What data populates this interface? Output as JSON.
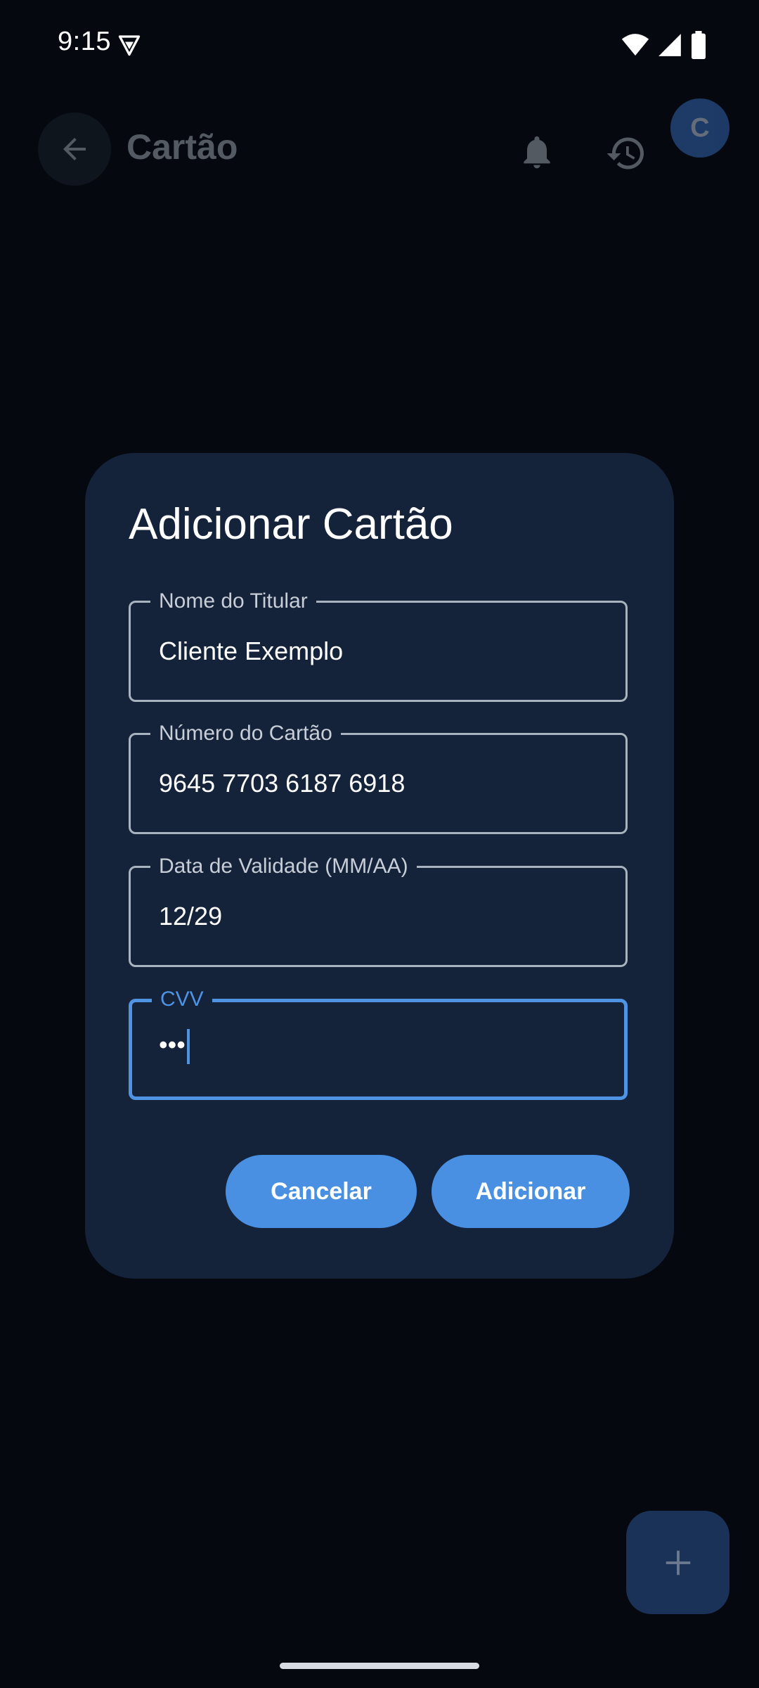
{
  "status_bar": {
    "time": "9:15"
  },
  "app_bar": {
    "title": "Cartão",
    "avatar_initial": "C"
  },
  "dialog": {
    "title": "Adicionar Cartão",
    "fields": [
      {
        "label": "Nome do Titular",
        "value": "Cliente Exemplo"
      },
      {
        "label": "Número do Cartão",
        "value": "9645 7703 6187 6918"
      },
      {
        "label": "Data de Validade (MM/AA)",
        "value": "12/29"
      },
      {
        "label": "CVV",
        "value": "•••"
      }
    ],
    "cancel_label": "Cancelar",
    "add_label": "Adicionar"
  },
  "colors": {
    "accent": "#4a90e2",
    "dialog_bg": "#14223a",
    "background": "#05090f"
  },
  "icons": [
    "vpn-key-icon",
    "wifi-icon",
    "signal-icon",
    "battery-icon",
    "arrow-back-icon",
    "bell-icon",
    "history-icon",
    "plus-icon"
  ]
}
